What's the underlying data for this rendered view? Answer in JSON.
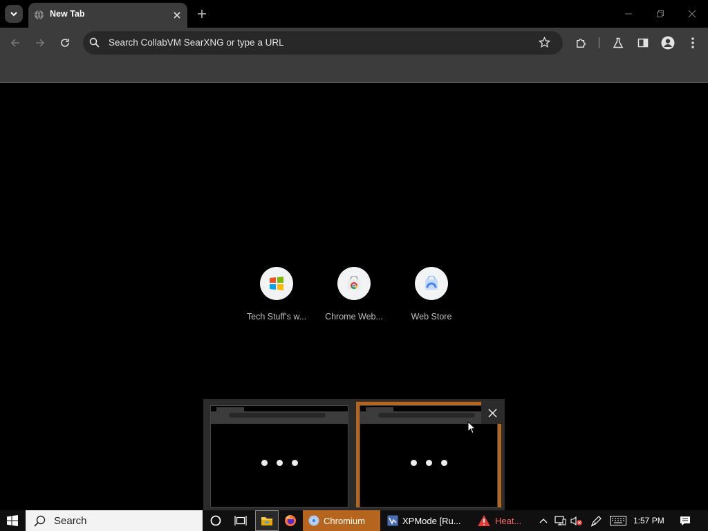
{
  "browser": {
    "tab": {
      "title": "New Tab"
    },
    "omnibox": {
      "placeholder": "Search CollabVM SearXNG or type a URL"
    },
    "icons": {
      "tab_search": "chevron-down-icon",
      "tab_favicon": "globe-icon",
      "tab_close": "close-icon",
      "new_tab": "plus-icon",
      "back": "back-arrow-icon",
      "forward": "forward-arrow-icon",
      "reload": "reload-icon",
      "search": "search-icon",
      "bookmark": "star-icon",
      "extensions": "puzzle-icon",
      "labs": "flask-icon",
      "side_panel": "side-panel-icon",
      "profile": "profile-icon",
      "menu": "kebab-menu-icon"
    }
  },
  "ntp": {
    "shortcuts": [
      {
        "label": "Tech Stuff's w...",
        "icon": "windows-logo-icon"
      },
      {
        "label": "Chrome Web...",
        "icon": "chrome-web-store-icon"
      },
      {
        "label": "Web Store",
        "icon": "web-store-icon"
      }
    ]
  },
  "taskbar": {
    "search_label": "Search",
    "apps": [
      {
        "label": "Chromium",
        "icon": "chromium-icon"
      },
      {
        "label": "XPMode [Ru...",
        "icon": "xpmode-icon"
      },
      {
        "label": "Heat...",
        "icon": "warning-icon"
      }
    ],
    "clock": "1:57 PM"
  },
  "colors": {
    "tab_bg": "#3c3c3c",
    "toolbar_bg": "#3c3c3c",
    "omnibox_bg": "#282828",
    "active_thumbnail_border": "#b5651d",
    "taskbar_active_app": "#b5651d"
  }
}
